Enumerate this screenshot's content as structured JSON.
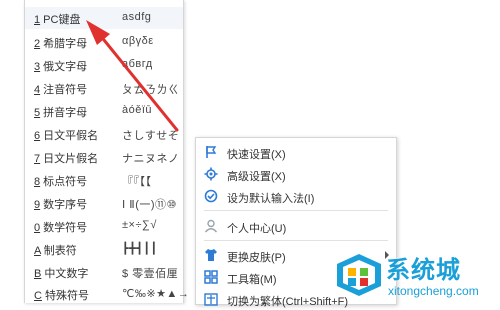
{
  "input_menu": {
    "items": [
      {
        "key": "1",
        "name": " PC键盘",
        "sample": "asdfg"
      },
      {
        "key": "2",
        "name": " 希腊字母",
        "sample": "αβγδε"
      },
      {
        "key": "3",
        "name": " 俄文字母",
        "sample": "абвгд"
      },
      {
        "key": "4",
        "name": " 注音符号",
        "sample": "ㄆㄊㄋㄌㄍ"
      },
      {
        "key": "5",
        "name": " 拼音字母",
        "sample": "àóěïū"
      },
      {
        "key": "6",
        "name": " 日文平假名",
        "sample": "さしすせそ"
      },
      {
        "key": "7",
        "name": " 日文片假名",
        "sample": "ナニヌネノ"
      },
      {
        "key": "8",
        "name": " 标点符号",
        "sample": "『『【【"
      },
      {
        "key": "9",
        "name": " 数字序号",
        "sample": "Ⅰ Ⅱ(一)⑪⑩"
      },
      {
        "key": "0",
        "name": " 数学符号",
        "sample": "±×÷∑√"
      },
      {
        "key": "A",
        "name": " 制表符",
        "sample": "┣╋┫┃┃"
      },
      {
        "key": "B",
        "name": " 中文数字",
        "sample": "$ 零壹佰厘"
      },
      {
        "key": "C",
        "name": " 特殊符号",
        "sample": "℃‰※★▲→"
      }
    ]
  },
  "context_menu": {
    "items": [
      {
        "label": "快速设置(X)",
        "icon": "flag-icon",
        "color": "#2e7bd6"
      },
      {
        "label": "高级设置(X)",
        "icon": "gear-icon",
        "color": "#2e7bd6"
      },
      {
        "label": "设为默认输入法(I)",
        "icon": "check-circle-icon",
        "color": "#2e7bd6"
      },
      {
        "label": "个人中心(U)",
        "icon": "person-icon",
        "color": "#9aa3ad"
      },
      {
        "label": "更换皮肤(P)",
        "icon": "shirt-icon",
        "color": "#2e7bd6"
      },
      {
        "label": "工具箱(M)",
        "icon": "grid-icon",
        "color": "#2e7bd6"
      },
      {
        "label": "切换为繁体(Ctrl+Shift+F)",
        "icon": "traditional-char-icon",
        "color": "#2e7bd6"
      }
    ]
  },
  "watermark": {
    "title": "系统城",
    "url": "xitongcheng.com"
  },
  "colors": {
    "arrow": "#e0312f",
    "accent": "#2e7bd6"
  }
}
